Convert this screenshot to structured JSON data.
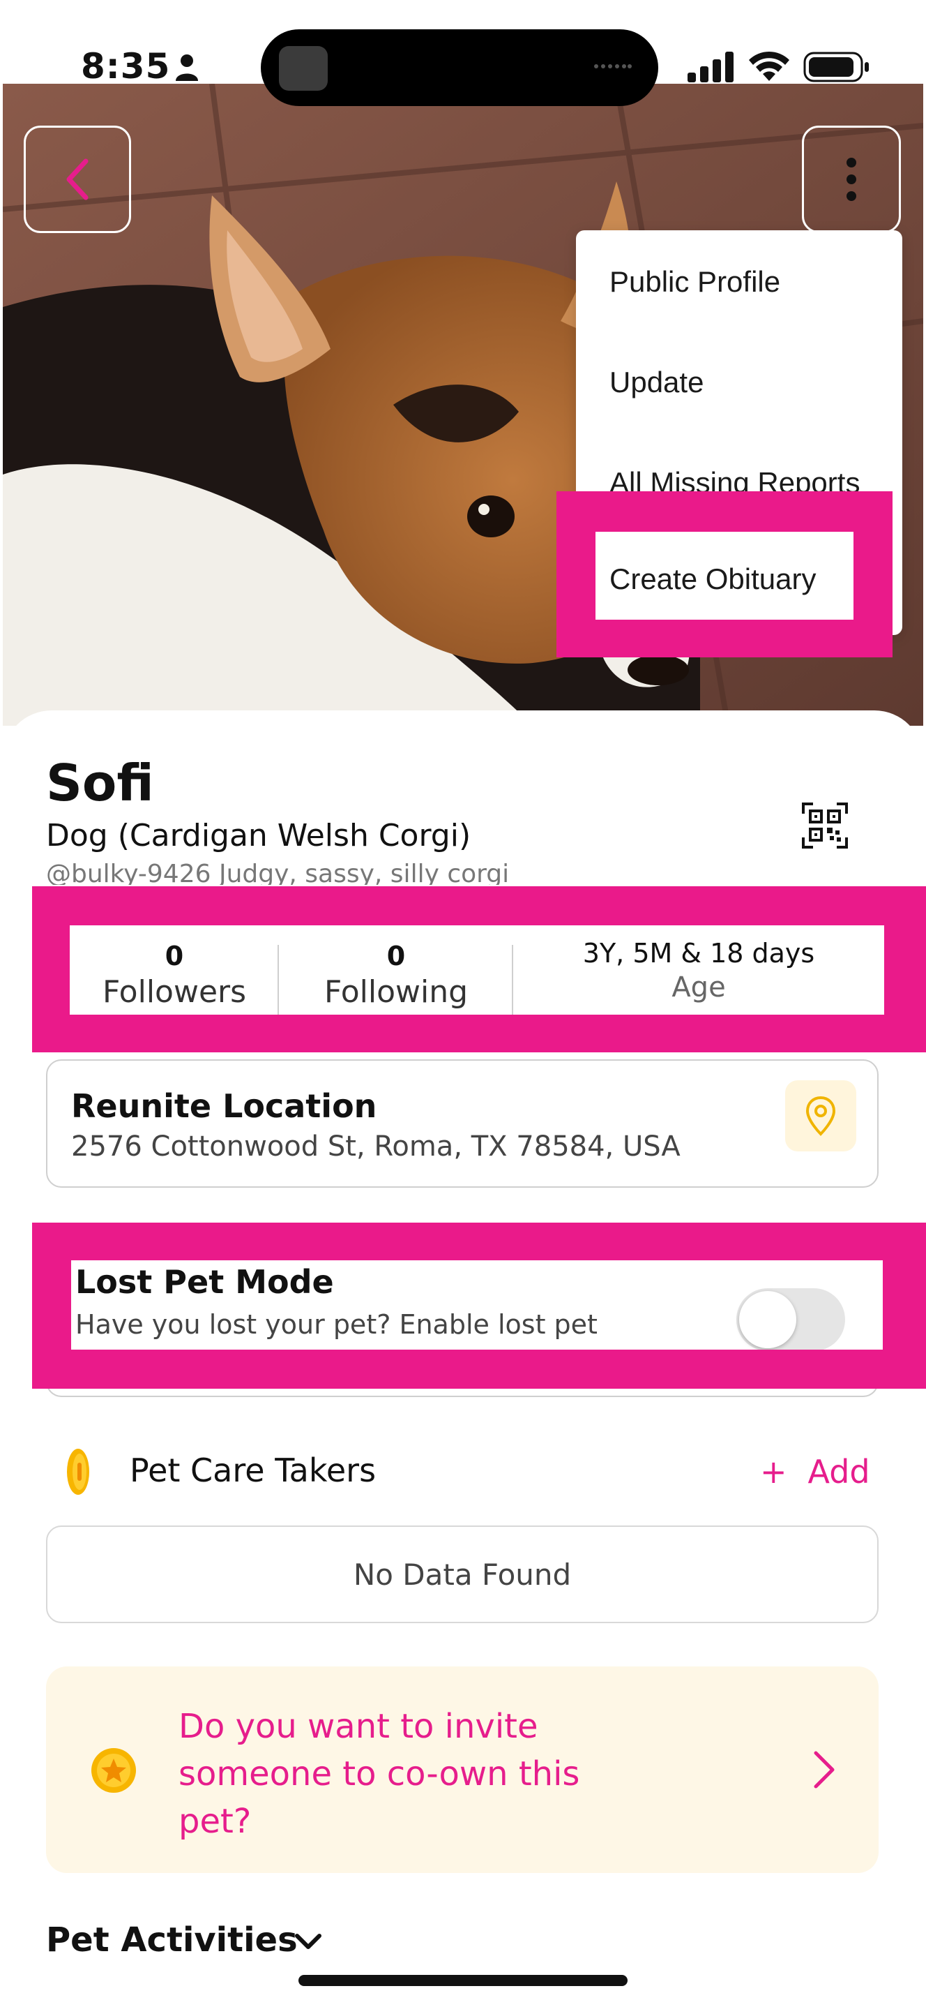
{
  "status_bar": {
    "time": "8:35"
  },
  "menu": {
    "items": [
      "Public Profile",
      "Update",
      "All Missing Reports"
    ],
    "highlighted_item": "Create Obituary"
  },
  "pet": {
    "name": "Sofi",
    "breed": "Dog (Cardigan Welsh Corgi)",
    "handle_bio": "@bulky-9426 Judgy, sassy, silly corgi"
  },
  "stats": {
    "followers_value": "0",
    "followers_label": "Followers",
    "following_value": "0",
    "following_label": "Following",
    "age_value": "3Y, 5M & 18 days",
    "age_label": "Age"
  },
  "reunite": {
    "title": "Reunite Location",
    "address": "2576 Cottonwood St, Roma, TX 78584, USA"
  },
  "lost_pet": {
    "title": "Lost Pet Mode",
    "description": "Have you lost your pet? Enable lost pet",
    "enabled": false
  },
  "caretakers": {
    "title": "Pet Care Takers",
    "add_label": "Add",
    "empty_text": "No Data Found"
  },
  "invite": {
    "text": "Do you want to invite someone to co-own this pet?"
  },
  "activities": {
    "title": "Pet Activities"
  },
  "colors": {
    "accent": "#e61d8c",
    "highlight": "#ea1a8a",
    "invite_bg": "#fef7e6",
    "pin_bg": "#fff5dc",
    "coin": "#f7b500"
  }
}
